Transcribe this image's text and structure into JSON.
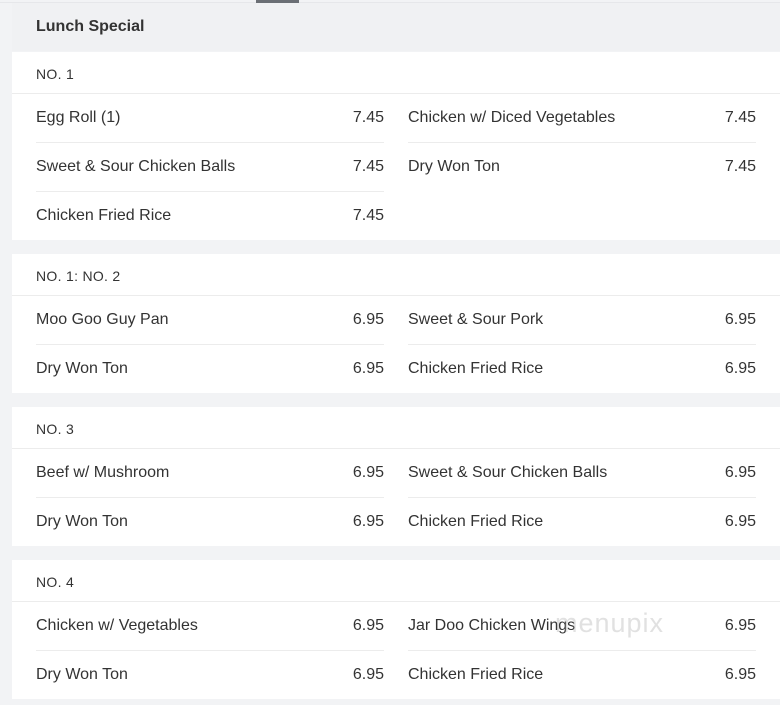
{
  "menu": {
    "title": "Lunch Special",
    "sections": [
      {
        "title": "NO. 1",
        "items": [
          {
            "name": "Egg Roll (1)",
            "price": "7.45"
          },
          {
            "name": "Chicken w/ Diced Vegetables",
            "price": "7.45"
          },
          {
            "name": "Sweet & Sour Chicken Balls",
            "price": "7.45"
          },
          {
            "name": "Dry Won Ton",
            "price": "7.45"
          },
          {
            "name": "Chicken Fried Rice",
            "price": "7.45"
          }
        ]
      },
      {
        "title": "NO. 1: NO. 2",
        "items": [
          {
            "name": "Moo Goo Guy Pan",
            "price": "6.95"
          },
          {
            "name": "Sweet & Sour Pork",
            "price": "6.95"
          },
          {
            "name": "Dry Won Ton",
            "price": "6.95"
          },
          {
            "name": "Chicken Fried Rice",
            "price": "6.95"
          }
        ]
      },
      {
        "title": "NO. 3",
        "items": [
          {
            "name": "Beef w/ Mushroom",
            "price": "6.95"
          },
          {
            "name": "Sweet & Sour Chicken Balls",
            "price": "6.95"
          },
          {
            "name": "Dry Won Ton",
            "price": "6.95"
          },
          {
            "name": "Chicken Fried Rice",
            "price": "6.95"
          }
        ]
      },
      {
        "title": "NO. 4",
        "items": [
          {
            "name": "Chicken w/ Vegetables",
            "price": "6.95"
          },
          {
            "name": "Jar Doo Chicken Wings",
            "price": "6.95"
          },
          {
            "name": "Dry Won Ton",
            "price": "6.95"
          },
          {
            "name": "Chicken Fried Rice",
            "price": "6.95"
          }
        ]
      }
    ]
  },
  "watermark": "menupix"
}
